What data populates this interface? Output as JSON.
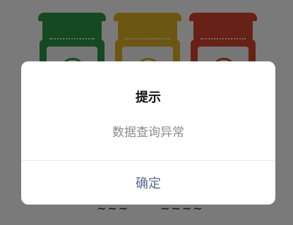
{
  "dialog": {
    "title": "提示",
    "message": "数据查询异常",
    "confirm_label": "确定"
  },
  "background": {
    "jars": [
      {
        "color": "#2f9a4a",
        "icon": "tree-icon"
      },
      {
        "color": "#e2b324",
        "icon": "cup-icon"
      },
      {
        "color": "#d9452f",
        "icon": "heart-icon"
      }
    ],
    "partial_values": [
      "~~~",
      "~~~~"
    ]
  },
  "colors": {
    "overlay": "rgba(0,0,0,0.52)",
    "dialog_bg": "#ffffff",
    "confirm_text": "#576b95",
    "message_text": "#8b8b8b"
  }
}
